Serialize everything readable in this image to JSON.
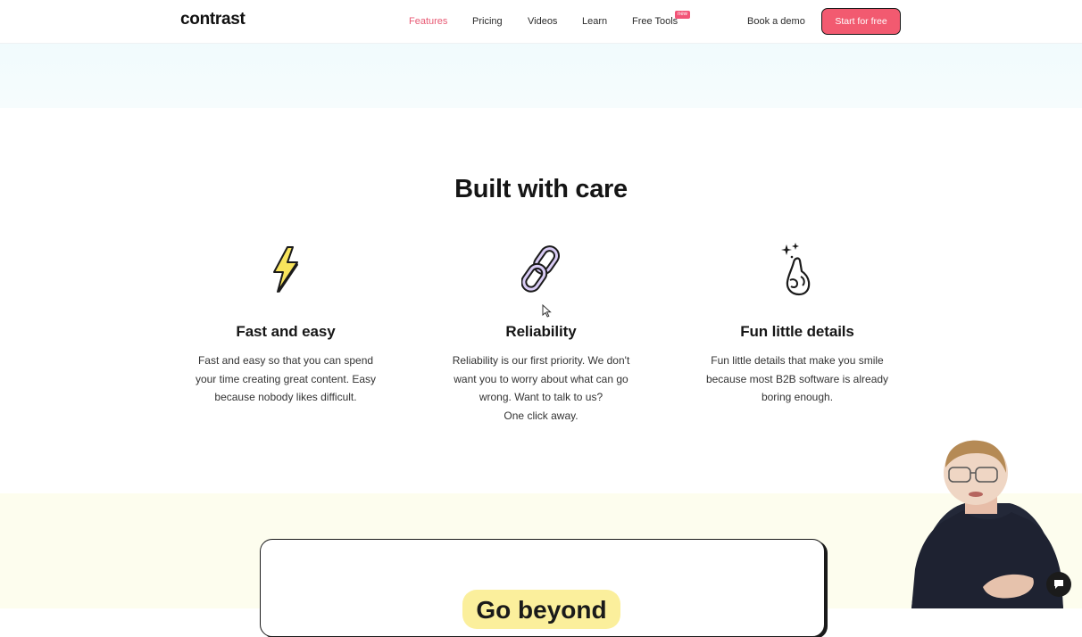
{
  "nav": {
    "logo": "contrast",
    "links": [
      "Features",
      "Pricing",
      "Videos",
      "Learn",
      "Free Tools"
    ],
    "new_badge": "new",
    "book_demo": "Book a demo",
    "cta": "Start for free",
    "active_link": "Features",
    "accent_color": "#f25a70"
  },
  "section": {
    "title": "Built with care",
    "features": [
      {
        "icon": "lightning-icon",
        "title": "Fast and easy",
        "lines": [
          "Fast and easy so that you can spend",
          "your time creating great content. Easy",
          "because nobody likes difficult."
        ]
      },
      {
        "icon": "chain-link-icon",
        "title": "Reliability",
        "lines": [
          "Reliability is our first priority. We don't",
          "want you to worry about what can go",
          "wrong. Want to talk to us?",
          "One click away."
        ]
      },
      {
        "icon": "finger-snap-sparkle-icon",
        "title": "Fun little details",
        "lines": [
          "Fun little details that make you smile",
          "because most B2B software is already",
          "boring enough."
        ]
      }
    ]
  },
  "next_section": {
    "heading": "Go beyond"
  },
  "widgets": {
    "chat_icon": "chat-icon",
    "webcam": "presenter-webcam-overlay"
  }
}
